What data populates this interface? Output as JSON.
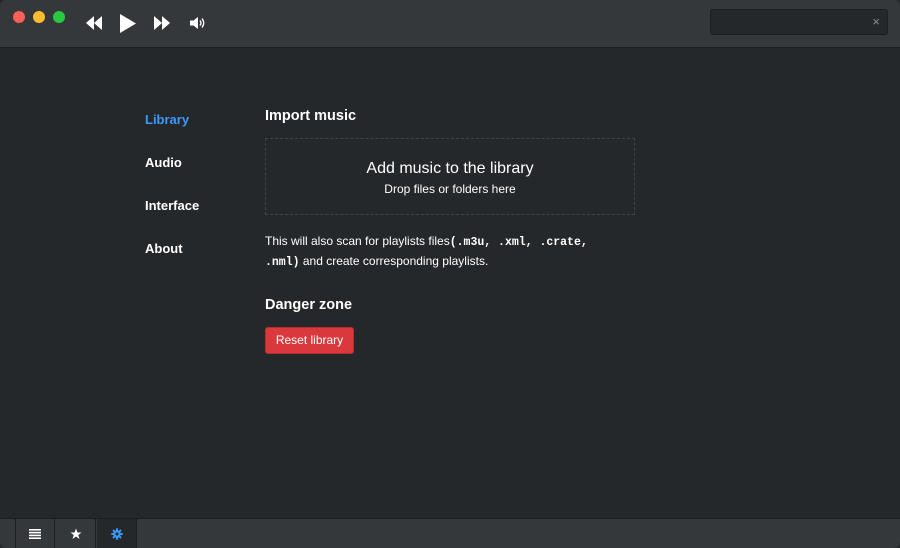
{
  "titlebar": {
    "search": {
      "value": "",
      "placeholder": "",
      "clear_icon": "×"
    },
    "controls": [
      "previous-icon",
      "play-icon",
      "next-icon",
      "volume-icon"
    ]
  },
  "sidebar": {
    "items": [
      {
        "label": "Library",
        "active": true
      },
      {
        "label": "Audio",
        "active": false
      },
      {
        "label": "Interface",
        "active": false
      },
      {
        "label": "About",
        "active": false
      }
    ]
  },
  "main": {
    "import_heading": "Import music",
    "dropzone": {
      "title": "Add music to the library",
      "subtitle": "Drop files or folders here"
    },
    "note": {
      "prefix": "This will also scan for playlists files",
      "formats_line1": "(.m3u, .xml, .crate,",
      "formats_line2": ".nml)",
      "suffix": " and create corresponding playlists."
    },
    "danger_heading": "Danger zone",
    "reset_button": "Reset library"
  },
  "footer": {
    "tabs": [
      {
        "icon": "list-icon",
        "active": false
      },
      {
        "icon": "star-icon",
        "active": false
      },
      {
        "icon": "gear-icon",
        "active": true
      }
    ]
  },
  "colors": {
    "background": "#25282b",
    "titlebar": "#35383b",
    "accent": "#3b99fc",
    "danger": "#d9383d"
  }
}
